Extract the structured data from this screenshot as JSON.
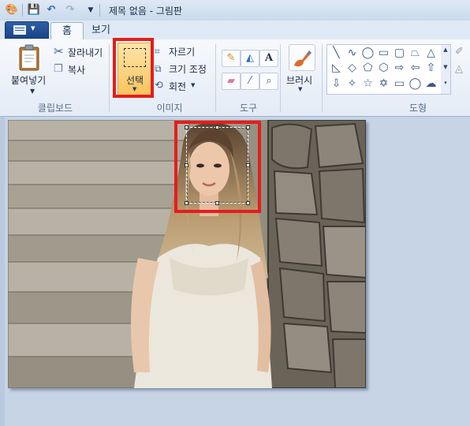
{
  "window": {
    "title": "제목 없음 - 그림판"
  },
  "quick_access": [
    "app-icon",
    "save-icon",
    "undo-icon",
    "redo-icon",
    "customize-icon"
  ],
  "tabs": {
    "home": "홈",
    "view": "보기"
  },
  "clipboard": {
    "paste": "붙여넣기",
    "cut": "잘라내기",
    "copy": "복사",
    "label": "클립보드"
  },
  "image": {
    "select": "선택",
    "crop": "자르기",
    "resize": "크기 조정",
    "rotate": "회전",
    "label": "이미지"
  },
  "tools": {
    "label": "도구"
  },
  "brushes": {
    "label": "브러시"
  },
  "shapes": {
    "label": "도형"
  },
  "colors": {
    "highlight_red": "#e51d1d",
    "select_fill": "#fbc35c",
    "ribbon_bg": "#f7f9fc",
    "workspace_bg": "#c7d4e6"
  }
}
